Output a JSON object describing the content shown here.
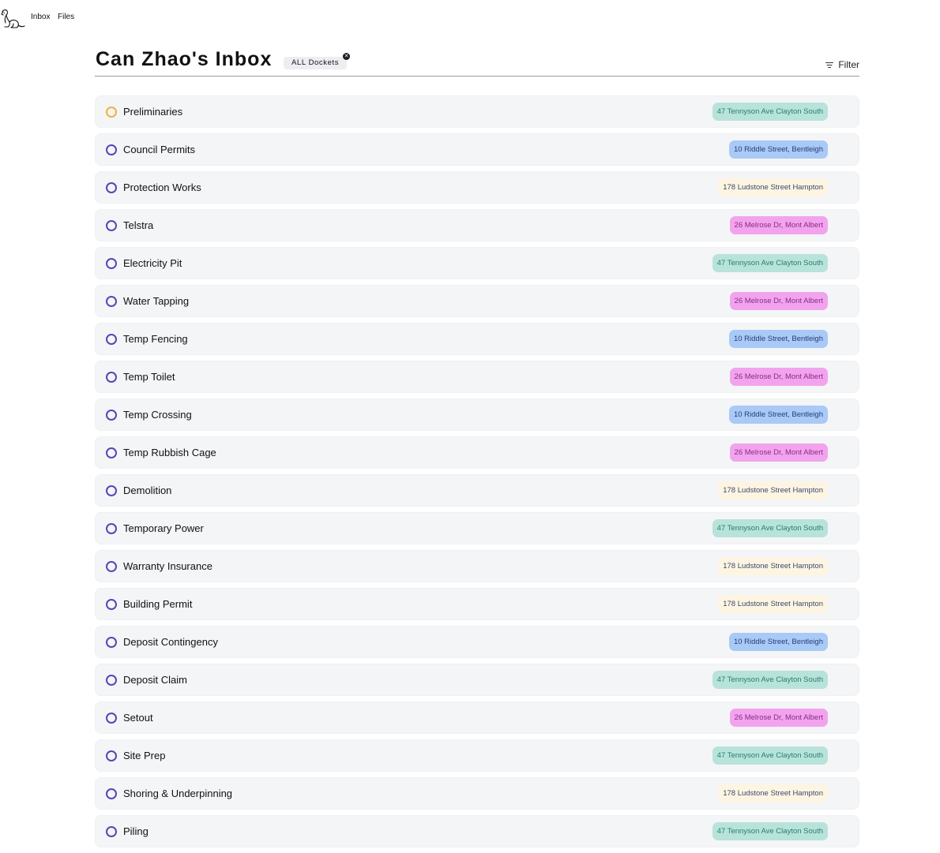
{
  "nav": {
    "logo_icon": "dog-icon",
    "links": [
      "Inbox",
      "Files"
    ]
  },
  "header": {
    "title": "Can Zhao's Inbox",
    "docket_chip": "ALL Dockets",
    "chip_close_icon": "close-circle-icon",
    "filter_label": "Filter",
    "filter_icon": "filter-lines-icon"
  },
  "tag_colors": {
    "tennyson": {
      "bg": "#b7e3da",
      "fg": "#2a7d70"
    },
    "riddle": {
      "bg": "#a9c9f7",
      "fg": "#23407a"
    },
    "ludstone": {
      "bg": "#fdf4e2",
      "fg": "#3b4a6e"
    },
    "melrose": {
      "bg": "#f2a3ee",
      "fg": "#8a2c83"
    }
  },
  "tasks": [
    {
      "name": "Preliminaries",
      "tag": "47 Tennyson Ave Clayton South",
      "tag_key": "tennyson",
      "status": "in-progress"
    },
    {
      "name": "Council Permits",
      "tag": "10 Riddle Street, Bentleigh",
      "tag_key": "riddle",
      "status": "open"
    },
    {
      "name": "Protection Works",
      "tag": "178 Ludstone Street Hampton",
      "tag_key": "ludstone",
      "status": "open"
    },
    {
      "name": "Telstra",
      "tag": "26 Melrose Dr, Mont Albert",
      "tag_key": "melrose",
      "status": "open"
    },
    {
      "name": "Electricity Pit",
      "tag": "47 Tennyson Ave Clayton South",
      "tag_key": "tennyson",
      "status": "open"
    },
    {
      "name": "Water Tapping",
      "tag": "26 Melrose Dr, Mont Albert",
      "tag_key": "melrose",
      "status": "open"
    },
    {
      "name": "Temp Fencing",
      "tag": "10 Riddle Street, Bentleigh",
      "tag_key": "riddle",
      "status": "open"
    },
    {
      "name": "Temp Toilet",
      "tag": "26 Melrose Dr, Mont Albert",
      "tag_key": "melrose",
      "status": "open"
    },
    {
      "name": "Temp Crossing",
      "tag": "10 Riddle Street, Bentleigh",
      "tag_key": "riddle",
      "status": "open"
    },
    {
      "name": "Temp Rubbish Cage",
      "tag": "26 Melrose Dr, Mont Albert",
      "tag_key": "melrose",
      "status": "open"
    },
    {
      "name": "Demolition",
      "tag": "178 Ludstone Street Hampton",
      "tag_key": "ludstone",
      "status": "open"
    },
    {
      "name": "Temporary Power",
      "tag": "47 Tennyson Ave Clayton South",
      "tag_key": "tennyson",
      "status": "open"
    },
    {
      "name": "Warranty Insurance",
      "tag": "178 Ludstone Street Hampton",
      "tag_key": "ludstone",
      "status": "open"
    },
    {
      "name": "Building Permit",
      "tag": "178 Ludstone Street Hampton",
      "tag_key": "ludstone",
      "status": "open"
    },
    {
      "name": "Deposit Contingency",
      "tag": "10 Riddle Street, Bentleigh",
      "tag_key": "riddle",
      "status": "open"
    },
    {
      "name": "Deposit Claim",
      "tag": "47 Tennyson Ave Clayton South",
      "tag_key": "tennyson",
      "status": "open"
    },
    {
      "name": "Setout",
      "tag": "26 Melrose Dr, Mont Albert",
      "tag_key": "melrose",
      "status": "open"
    },
    {
      "name": "Site Prep",
      "tag": "47 Tennyson Ave Clayton South",
      "tag_key": "tennyson",
      "status": "open"
    },
    {
      "name": "Shoring & Underpinning",
      "tag": "178 Ludstone Street Hampton",
      "tag_key": "ludstone",
      "status": "open"
    },
    {
      "name": "Piling",
      "tag": "47 Tennyson Ave Clayton South",
      "tag_key": "tennyson",
      "status": "open"
    }
  ]
}
